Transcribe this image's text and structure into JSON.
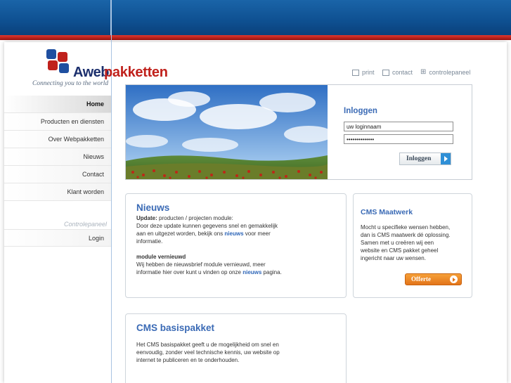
{
  "logo": {
    "part1": "Aweb",
    "part2": "pakketten",
    "tagline": "Connecting you to the world"
  },
  "util": {
    "print": "print",
    "contact": "contact",
    "controlepaneel": "controlepaneel"
  },
  "nav": {
    "items": [
      "Home",
      "Producten en diensten",
      "Over Webpakketten",
      "Nieuws",
      "Contact",
      "Klant worden"
    ],
    "section_title": "Controlepaneel",
    "login": "Login"
  },
  "login": {
    "title": "Inloggen",
    "username_value": "uw loginnaam",
    "password_value": "••••••••••••••",
    "button": "Inloggen"
  },
  "news": {
    "title": "Nieuws",
    "update_label": "Update:",
    "update_rest": " producten / projecten module:",
    "line2a": "Door deze update kunnen gegevens snel en gemakkelijk",
    "line3a": "aan en uitgezet worden, bekijk ons ",
    "kw1": "nieuws",
    "line3b": " voor meer",
    "line4": "informatie.",
    "module_title": "module vernieuwd",
    "module_l1": "Wij hebben de nieuwsbrief module vernieuwd, meer",
    "module_l2a": "informatie hier over kunt u vinden op onze ",
    "kw2": "nieuws",
    "module_l2b": " pagina."
  },
  "maatwerk": {
    "title": "CMS Maatwerk",
    "l1": "Mocht u specifieke wensen hebben,",
    "l2": "dan is CMS maatwerk dé oplossing.",
    "l3": "Samen met u creëren wij een",
    "l4": "website en CMS pakket geheel",
    "l5": "ingericht naar uw wensen.",
    "button": "Offerte"
  },
  "basis": {
    "title": "CMS basispakket",
    "l1": "Het CMS basispakket geeft u de mogelijkheid om snel en",
    "l2": "eenvoudig, zonder veel technische kennis, uw website op",
    "l3": "internet te publiceren en te onderhouden."
  },
  "colors": {
    "brand_blue": "#1a64a8",
    "brand_red": "#c0211c",
    "accent_orange": "#e3741a",
    "link_blue": "#3a6ab5"
  }
}
